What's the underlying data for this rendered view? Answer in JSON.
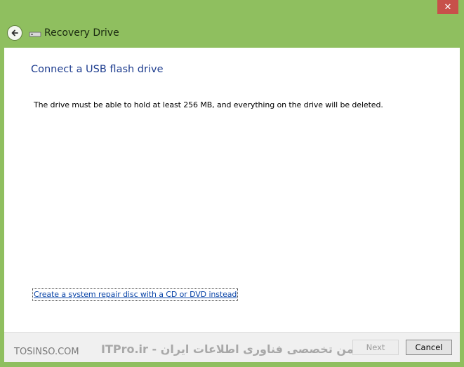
{
  "window": {
    "title": "Recovery Drive",
    "close_symbol": "✕",
    "back_icon": "back-arrow-icon",
    "title_icon": "usb-drive-icon"
  },
  "content": {
    "heading": "Connect a USB flash drive",
    "description": "The drive must be able to hold at least 256 MB, and everything on the drive will be deleted.",
    "link": "Create a system repair disc with a CD or DVD instead"
  },
  "footer": {
    "watermark_left": "TOSINSO.COM",
    "watermark_right": "ITPro.ir - انجمن تخصصی فناوری اطلاعات ایران",
    "next_label": "Next",
    "cancel_label": "Cancel"
  },
  "colors": {
    "frame": "#8fbf5f",
    "heading": "#1e3d8f",
    "link": "#0a45a8",
    "close": "#c7504a"
  }
}
